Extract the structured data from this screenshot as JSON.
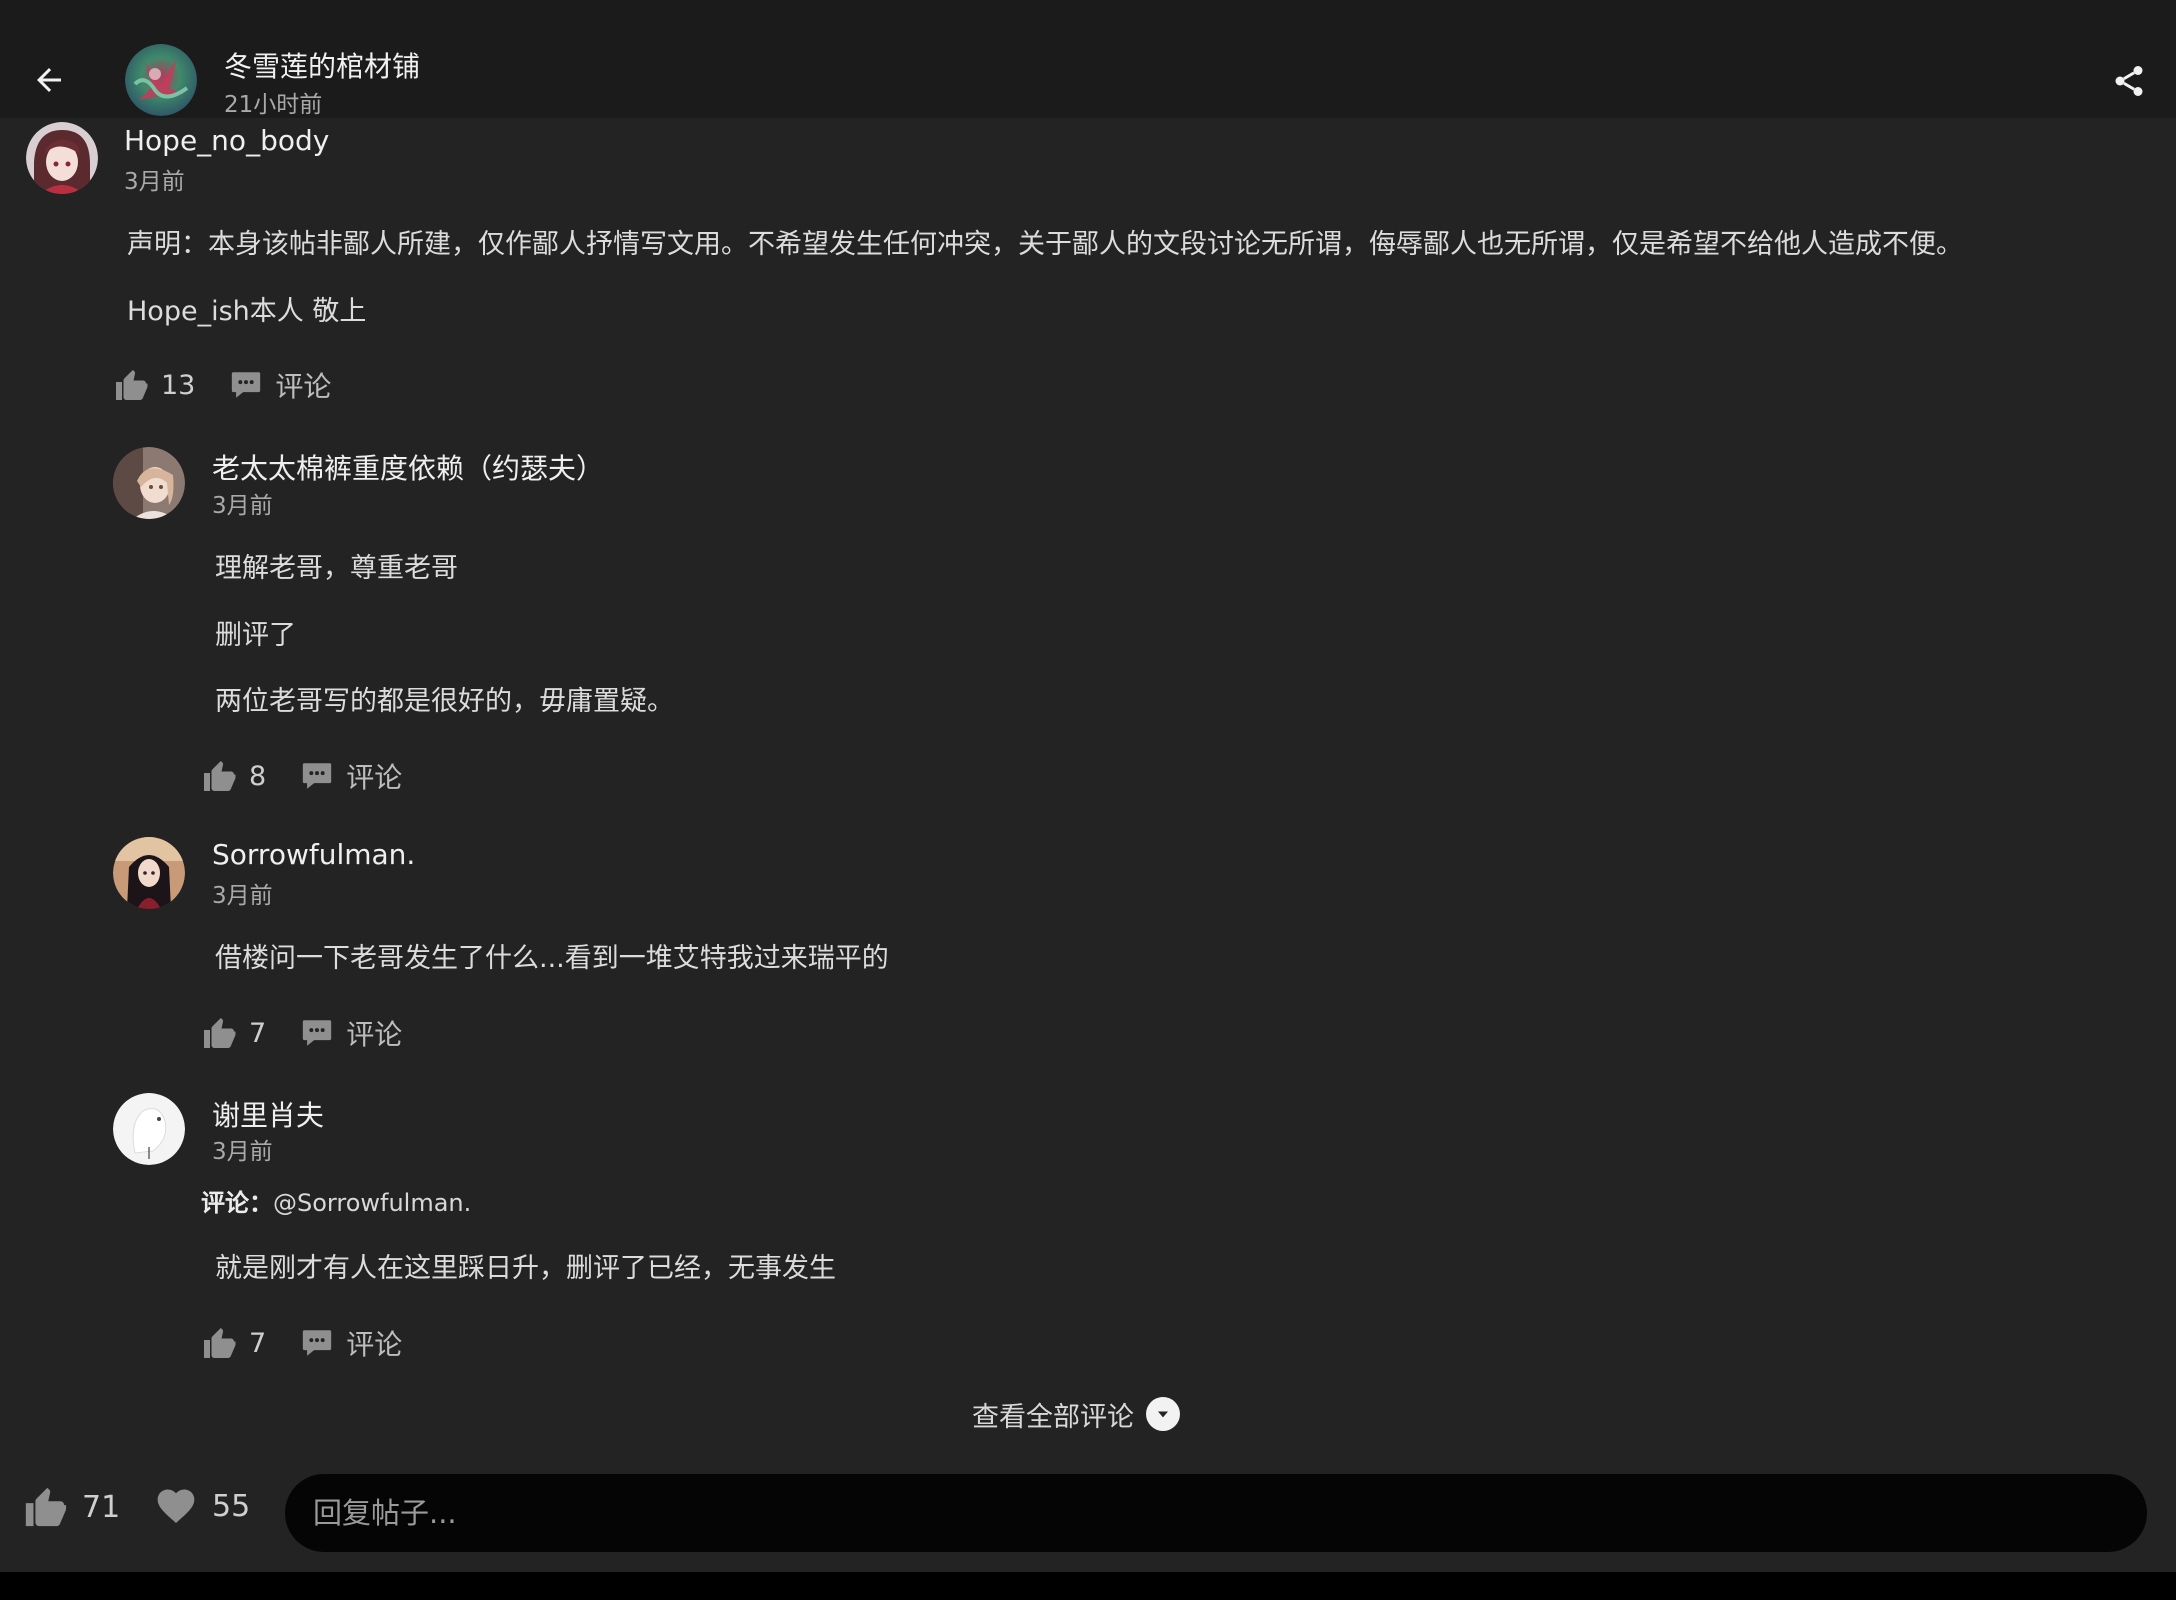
{
  "header": {
    "title": "冬雪莲的棺材铺",
    "time": "21小时前"
  },
  "comments": [
    {
      "user": "Hope_no_body",
      "time": "3月前",
      "lines": [
        "声明：本身该帖非鄙人所建，仅作鄙人抒情写文用。不希望发生任何冲突，关于鄙人的文段讨论无所谓，侮辱鄙人也无所谓，仅是希望不给他人造成不便。",
        "Hope_ish本人 敬上"
      ],
      "likes": "13",
      "comment_label": "评论"
    },
    {
      "user": "老太太棉裤重度依赖（约瑟夫）",
      "time": "3月前",
      "lines": [
        "理解老哥，尊重老哥",
        "删评了",
        "两位老哥写的都是很好的，毋庸置疑。"
      ],
      "likes": "8",
      "comment_label": "评论"
    },
    {
      "user": "Sorrowfulman.",
      "time": "3月前",
      "lines": [
        "借楼问一下老哥发生了什么...看到一堆艾特我过来瑞平的"
      ],
      "likes": "7",
      "comment_label": "评论"
    },
    {
      "user": "谢里肖夫",
      "time": "3月前",
      "reply_prefix_label": "评论：",
      "reply_target": "@Sorrowfulman.",
      "lines": [
        "就是刚才有人在这里踩日升，删评了已经，无事发生"
      ],
      "likes": "7",
      "comment_label": "评论"
    }
  ],
  "view_all_label": "查看全部评论",
  "bottom": {
    "like_count": "71",
    "fav_count": "55",
    "reply_placeholder": "回复帖子..."
  },
  "colors": {
    "background": "#232323",
    "header_background": "#1b1b1b",
    "input_background": "#050505"
  },
  "icons": [
    "back-arrow-icon",
    "share-icon",
    "thumbs-up-icon",
    "comment-bubble-icon",
    "chevron-down-icon",
    "heart-icon"
  ]
}
